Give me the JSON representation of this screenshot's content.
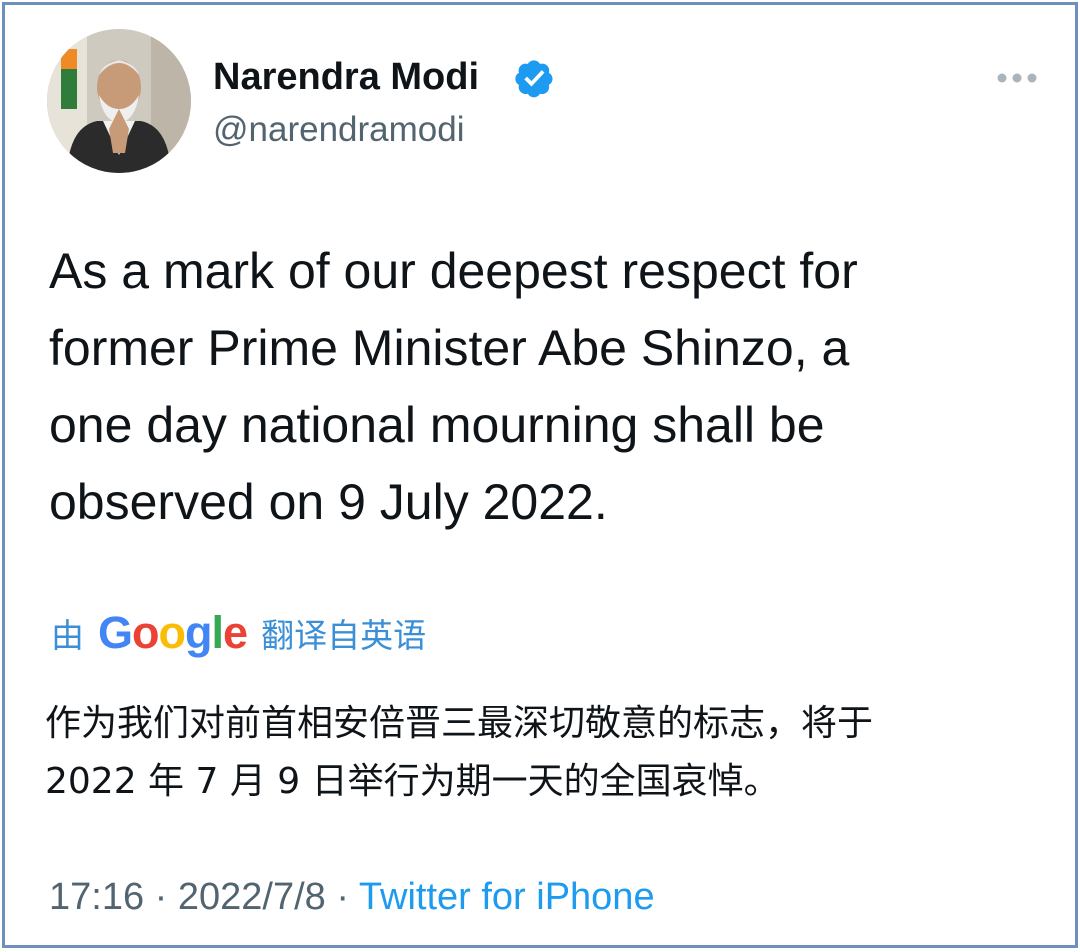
{
  "author": {
    "display_name": "Narendra Modi",
    "handle": "@narendramodi",
    "verified": true,
    "verified_color": "#1d9bf0"
  },
  "tweet": {
    "text": "As a mark of our deepest respect for\nformer Prime Minister Abe Shinzo, a\none day national mourning shall be\nobserved on 9 July 2022."
  },
  "translation": {
    "by_label": "由",
    "provider": "Google",
    "from_label": "翻译自英语",
    "text": "作为我们对前首相安倍晋三最深切敬意的标志，将于\n2022 年 7 月 9 日举行为期一天的全国哀悼。"
  },
  "meta": {
    "time": "17:16",
    "separator": "·",
    "date": "2022/7/8",
    "source": "Twitter for iPhone"
  },
  "icons": {
    "more": "more-horizontal-icon",
    "verified": "verified-badge-icon"
  },
  "colors": {
    "accent": "#1d9bf0",
    "text_primary": "#0f1419",
    "text_secondary": "#536471",
    "frame_border": "#6f8fbf"
  }
}
